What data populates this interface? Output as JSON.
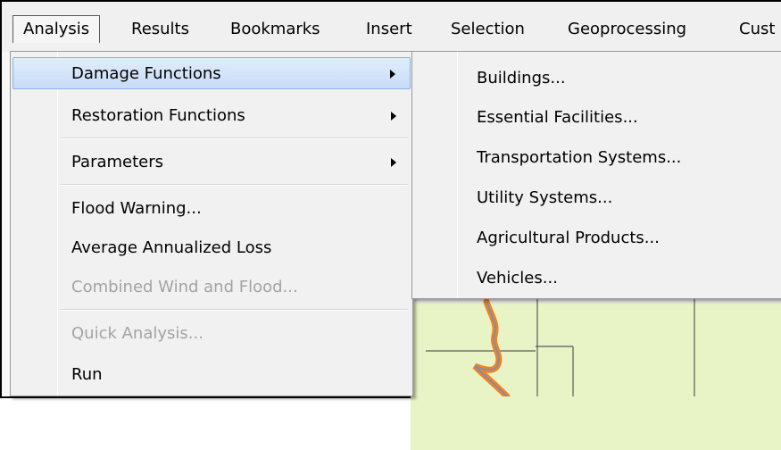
{
  "menubar": {
    "items": [
      {
        "label": "Analysis"
      },
      {
        "label": "Results"
      },
      {
        "label": "Bookmarks"
      },
      {
        "label": "Insert"
      },
      {
        "label": "Selection"
      },
      {
        "label": "Geoprocessing"
      },
      {
        "label": "Cust"
      }
    ]
  },
  "analysis_menu": {
    "items": [
      {
        "label": "Damage Functions",
        "submenu": true,
        "highlighted": true
      },
      {
        "label": "Restoration Functions",
        "submenu": true
      },
      {
        "label": "Parameters",
        "submenu": true
      },
      {
        "label": "Flood Warning..."
      },
      {
        "label": "Average Annualized Loss"
      },
      {
        "label": "Combined Wind and Flood...",
        "disabled": true
      },
      {
        "label": "Quick Analysis...",
        "disabled": true
      },
      {
        "label": "Run"
      }
    ]
  },
  "damage_functions_submenu": {
    "items": [
      {
        "label": "Buildings..."
      },
      {
        "label": "Essential Facilities..."
      },
      {
        "label": "Transportation Systems..."
      },
      {
        "label": "Utility Systems..."
      },
      {
        "label": "Agricultural Products..."
      },
      {
        "label": "Vehicles..."
      }
    ]
  },
  "colors": {
    "highlight": "#c6dcf6",
    "map_fill": "#e8f4c6",
    "river": "#f58220",
    "disabled_text": "#a3a3a3"
  }
}
